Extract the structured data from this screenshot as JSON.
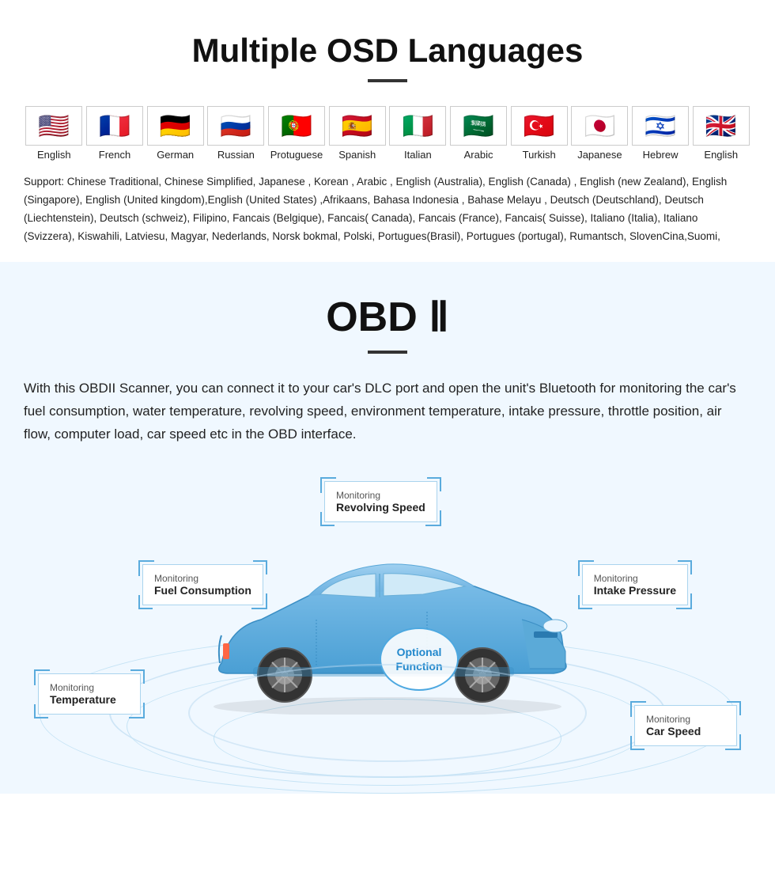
{
  "osd": {
    "title": "Multiple OSD Languages",
    "flags": [
      {
        "emoji": "🇺🇸",
        "label": "English"
      },
      {
        "emoji": "🇫🇷",
        "label": "French"
      },
      {
        "emoji": "🇩🇪",
        "label": "German"
      },
      {
        "emoji": "🇷🇺",
        "label": "Russian"
      },
      {
        "emoji": "🇵🇹",
        "label": "Protuguese"
      },
      {
        "emoji": "🇪🇸",
        "label": "Spanish"
      },
      {
        "emoji": "🇮🇹",
        "label": "Italian"
      },
      {
        "emoji": "🇸🇦",
        "label": "Arabic"
      },
      {
        "emoji": "🇹🇷",
        "label": "Turkish"
      },
      {
        "emoji": "🇯🇵",
        "label": "Japanese"
      },
      {
        "emoji": "🇮🇱",
        "label": "Hebrew"
      },
      {
        "emoji": "🇬🇧",
        "label": "English"
      }
    ],
    "support_text": "Support: Chinese Traditional, Chinese Simplified, Japanese , Korean , Arabic , English (Australia), English (Canada) , English (new Zealand), English (Singapore), English (United kingdom),English (United States) ,Afrikaans, Bahasa Indonesia , Bahase Melayu , Deutsch (Deutschland), Deutsch (Liechtenstein), Deutsch (schweiz), Filipino, Fancais (Belgique), Fancais( Canada), Fancais (France), Fancais( Suisse), Italiano (Italia), Italiano (Svizzera), Kiswahili, Latviesu, Magyar, Nederlands, Norsk bokmal, Polski, Portugues(Brasil), Portugues (portugal), Rumantsch, SlovenCina,Suomi,"
  },
  "obd": {
    "title": "OBD Ⅱ",
    "description": "With this OBDII Scanner, you can connect it to your car's DLC port and open the unit's Bluetooth for monitoring the car's fuel consumption, water temperature, revolving speed, environment temperature, intake pressure, throttle position, air flow, computer load, car speed etc in the OBD interface.",
    "monitors": {
      "revolving": {
        "label": "Monitoring",
        "value": "Revolving Speed"
      },
      "fuel": {
        "label": "Monitoring",
        "value": "Fuel Consumption"
      },
      "intake": {
        "label": "Monitoring",
        "value": "Intake Pressure"
      },
      "temperature": {
        "label": "Monitoring",
        "value": "Temperature"
      },
      "speed": {
        "label": "Monitoring",
        "value": "Car Speed"
      }
    },
    "optional": {
      "line1": "Optional",
      "line2": "Function"
    }
  }
}
